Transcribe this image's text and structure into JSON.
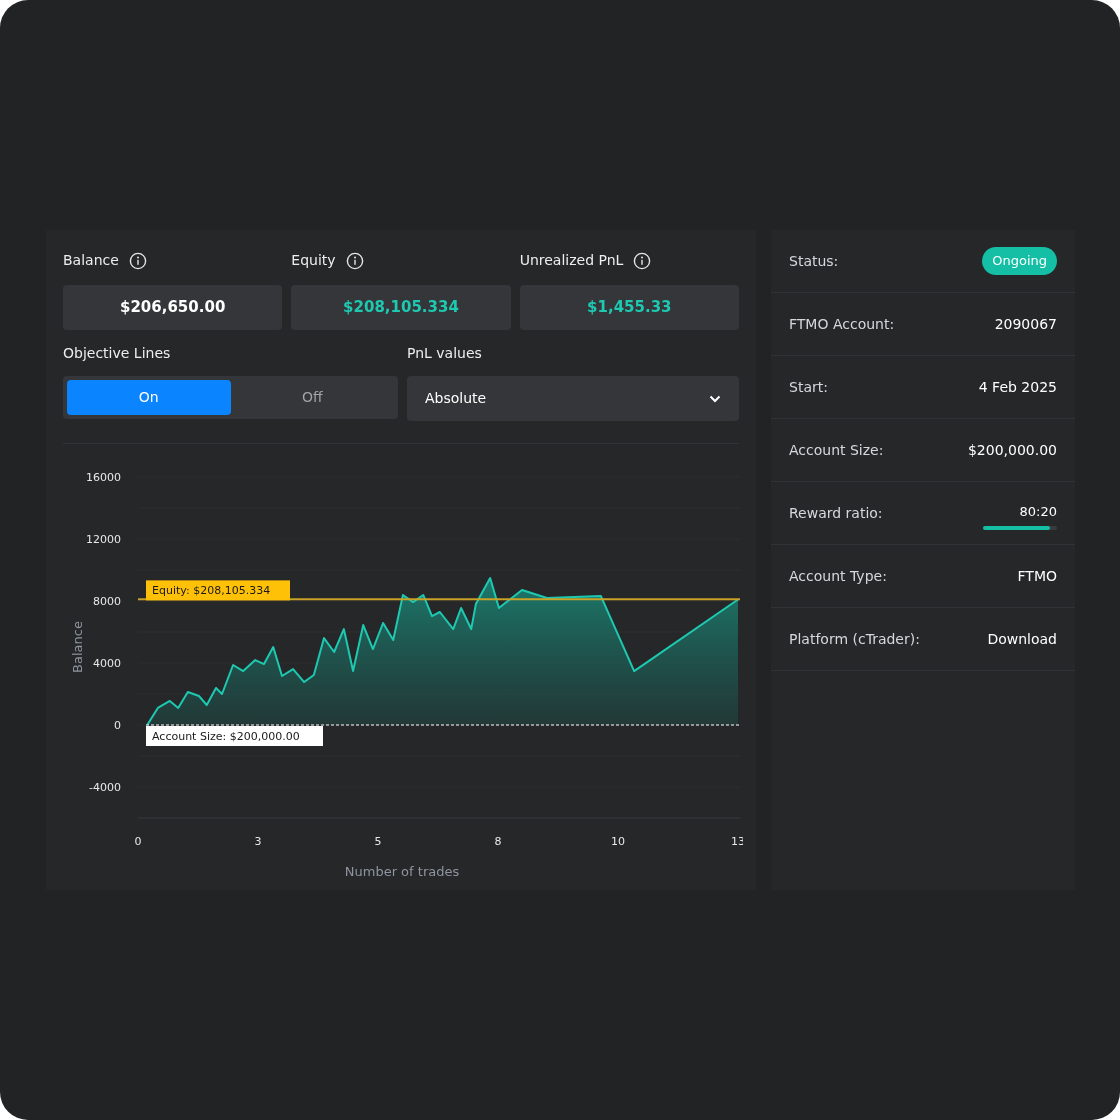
{
  "stats": [
    {
      "label": "Balance",
      "value": "$206,650.00",
      "color": "#ffffff"
    },
    {
      "label": "Equity",
      "value": "$208,105.334",
      "color": "#1dc9b0"
    },
    {
      "label": "Unrealized PnL",
      "value": "$1,455.33",
      "color": "#1dc9b0"
    }
  ],
  "objective_lines": {
    "label": "Objective Lines",
    "options": [
      {
        "label": "On",
        "selected": true
      },
      {
        "label": "Off",
        "selected": false
      }
    ]
  },
  "pnl_values": {
    "label": "PnL values",
    "value": "Absolute"
  },
  "chart_data": {
    "type": "area",
    "xlabel": "Number of trades",
    "ylabel": "Balance",
    "x": [
      0.2,
      0.43,
      0.69,
      0.87,
      1.08,
      1.32,
      1.49,
      1.69,
      1.82,
      2.06,
      2.28,
      2.54,
      2.73,
      2.93,
      3.12,
      3.36,
      3.6,
      3.81,
      4.03,
      4.25,
      4.46,
      4.66,
      4.88,
      5.09,
      5.31,
      5.53,
      5.74,
      5.96,
      6.18,
      6.37,
      6.54,
      6.83,
      7.0,
      7.22,
      7.32,
      7.63,
      7.82,
      8.32,
      8.86,
      10.03,
      10.75,
      13
    ],
    "series": [
      {
        "color": "#1dc9b0",
        "values": [
          0,
          1100,
          1550,
          1100,
          2130,
          1870,
          1290,
          2390,
          2000,
          3870,
          3480,
          4190,
          3930,
          5030,
          3160,
          3610,
          2770,
          3230,
          5610,
          4710,
          6190,
          3480,
          6450,
          4900,
          6580,
          5480,
          8390,
          7930,
          8390,
          7030,
          7290,
          6190,
          7550,
          6190,
          7800,
          9480,
          7550,
          8710,
          8190,
          8320,
          3480,
          8100
        ]
      }
    ],
    "xlim": [
      0,
      13
    ],
    "ylim": [
      -6000,
      16000
    ],
    "xticks": [
      {
        "value": 0,
        "label": "0"
      },
      {
        "value": 2.6,
        "label": "3"
      },
      {
        "value": 5.2,
        "label": "5"
      },
      {
        "value": 7.8,
        "label": "8"
      },
      {
        "value": 10.4,
        "label": "10"
      },
      {
        "value": 13,
        "label": "13"
      }
    ],
    "yticks": [
      16000,
      12000,
      8000,
      4000,
      0,
      -4000
    ],
    "ref_lines": [
      {
        "axis": "y",
        "value": 8105,
        "color": "#c9a227"
      },
      {
        "axis": "y",
        "value": 0,
        "color": "#ffffff"
      }
    ],
    "annotations": [
      "Equity: $208,105.334",
      "Account Size: $200,000.00"
    ]
  },
  "details": [
    {
      "kind": "badge",
      "label": "Status:",
      "value": "Ongoing"
    },
    {
      "kind": "text",
      "label": "FTMO Account:",
      "value": "2090067"
    },
    {
      "kind": "text",
      "label": "Start:",
      "value": "4 Feb 2025"
    },
    {
      "kind": "text",
      "label": "Account Size:",
      "value": "$200,000.00"
    },
    {
      "kind": "progress",
      "label": "Reward ratio:",
      "value": "80:20",
      "level": 0.9
    },
    {
      "kind": "text",
      "label": "Account Type:",
      "value": "FTMO"
    },
    {
      "kind": "text",
      "label": "Platform (cTrader):",
      "value": "Download"
    }
  ]
}
